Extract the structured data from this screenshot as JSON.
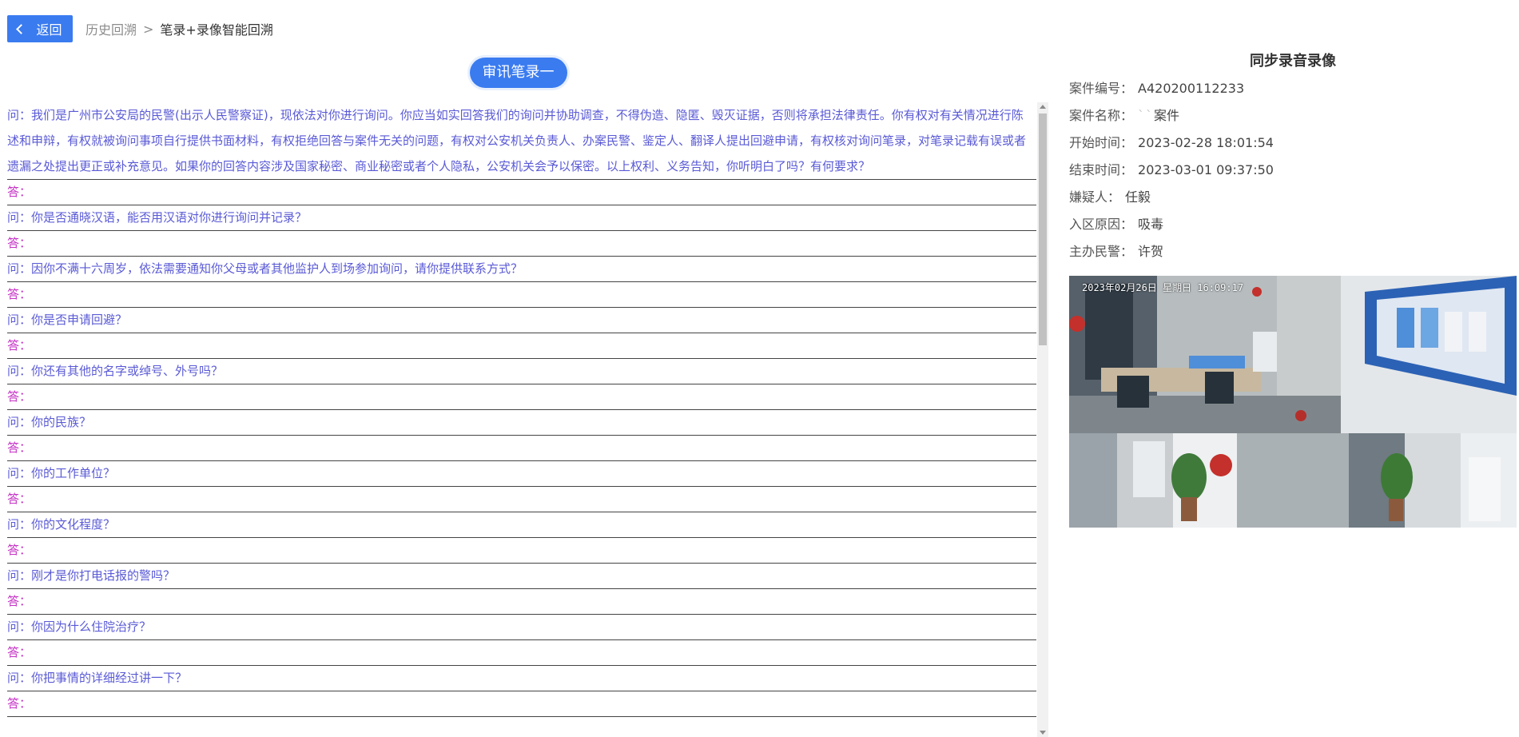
{
  "topbar": {
    "back_label": "返回",
    "breadcrumb_prev": "历史回溯",
    "breadcrumb_sep": ">",
    "breadcrumb_current": "笔录+录像智能回溯"
  },
  "record": {
    "title": "审讯笔录一",
    "intro": "问：我们是广州市公安局的民警(出示人民警察证)，现依法对你进行询问。你应当如实回答我们的询问并协助调查，不得伪造、隐匿、毁灭证据，否则将承担法律责任。你有权对有关情况进行陈述和申辩，有权就被询问事项自行提供书面材料，有权拒绝回答与案件无关的问题，有权对公安机关负责人、办案民警、鉴定人、翻译人提出回避申请，有权核对询问笔录，对笔录记载有误或者遗漏之处提出更正或补充意见。如果你的回答内容涉及国家秘密、商业秘密或者个人隐私，公安机关会予以保密。以上权利、义务告知，你听明白了吗？有何要求？",
    "lines": [
      {
        "type": "a",
        "text": "答："
      },
      {
        "type": "q",
        "text": "问：你是否通晓汉语，能否用汉语对你进行询问并记录？"
      },
      {
        "type": "a",
        "text": "答："
      },
      {
        "type": "q",
        "text": "问：因你不满十六周岁，依法需要通知你父母或者其他监护人到场参加询问，请你提供联系方式？"
      },
      {
        "type": "a",
        "text": "答："
      },
      {
        "type": "q",
        "text": "问：你是否申请回避？"
      },
      {
        "type": "a",
        "text": "答："
      },
      {
        "type": "q",
        "text": "问：你还有其他的名字或绰号、外号吗？"
      },
      {
        "type": "a",
        "text": "答："
      },
      {
        "type": "q",
        "text": "问：你的民族？"
      },
      {
        "type": "a",
        "text": "答："
      },
      {
        "type": "q",
        "text": "问：你的工作单位？"
      },
      {
        "type": "a",
        "text": "答："
      },
      {
        "type": "q",
        "text": "问：你的文化程度？"
      },
      {
        "type": "a",
        "text": "答："
      },
      {
        "type": "q",
        "text": "问：刚才是你打电话报的警吗？"
      },
      {
        "type": "a",
        "text": "答："
      },
      {
        "type": "q",
        "text": "问：你因为什么住院治疗？"
      },
      {
        "type": "a",
        "text": "答："
      },
      {
        "type": "q",
        "text": "问：你把事情的详细经过讲一下？"
      },
      {
        "type": "a",
        "text": "答："
      }
    ]
  },
  "panel": {
    "title": "同步录音录像",
    "case_no_label": "案件编号：",
    "case_no": "A420200112233",
    "case_name_label": "案件名称：",
    "case_name_blur": "``",
    "case_name_suffix": "案件",
    "start_label": "开始时间：",
    "start": "2023-02-28 18:01:54",
    "end_label": "结束时间：",
    "end": "2023-03-01 09:37:50",
    "suspect_label": "嫌疑人：",
    "suspect": "任毅",
    "reason_label": "入区原因：",
    "reason": "吸毒",
    "officer_label": "主办民警：",
    "officer": "许贺",
    "video_timestamp": "2023年02月26日  星期日  16:09:17"
  },
  "colors": {
    "accent": "#3a7bf0",
    "question": "#5a5ad6",
    "answer": "#c531c5"
  }
}
